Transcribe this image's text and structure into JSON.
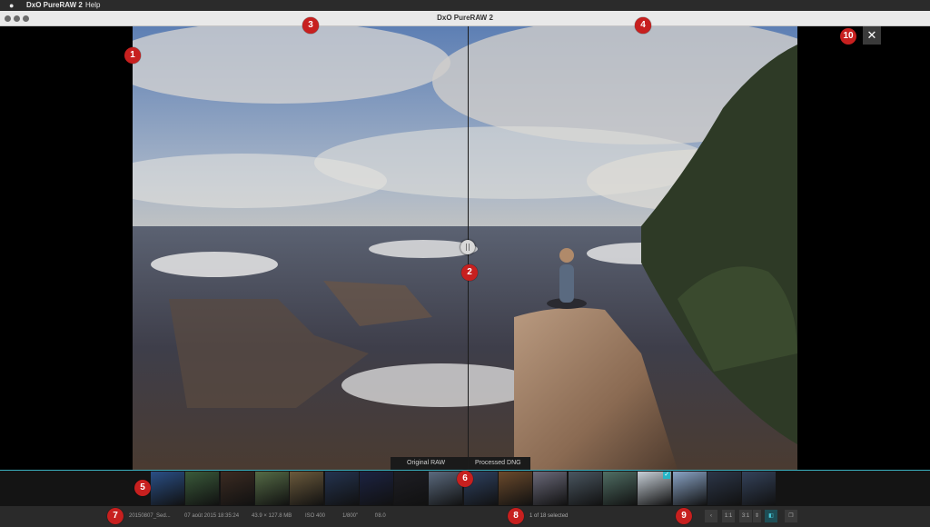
{
  "menubar": {
    "app": "DxO PureRAW 2",
    "help": "Help"
  },
  "window": {
    "title": "DxO PureRAW 2"
  },
  "compare": {
    "original_label": "Original RAW",
    "processed_label": "Processed DNG"
  },
  "close_label": "✕",
  "filmstrip": {
    "thumbnails": [
      {
        "color": "#2a4f86"
      },
      {
        "color": "#3a5a3a"
      },
      {
        "color": "#3b2b22"
      },
      {
        "color": "#556b46"
      },
      {
        "color": "#6b5a3c"
      },
      {
        "color": "#24334f"
      },
      {
        "color": "#1c2342"
      },
      {
        "color": "#1e1e24"
      },
      {
        "color": "#5b6a7e"
      },
      {
        "color": "#2f4262"
      },
      {
        "color": "#6b4a2c"
      },
      {
        "color": "#6b6a7a"
      },
      {
        "color": "#4a5660"
      },
      {
        "color": "#506e64"
      },
      {
        "color": "#c8d0d8",
        "checked": true
      },
      {
        "color": "#8aa4c6"
      },
      {
        "color": "#2c3648"
      },
      {
        "color": "#34425a"
      }
    ]
  },
  "status": {
    "filename": "20150807_Sed...",
    "datetime": "07 août 2015 18:35:24",
    "size": "43.9 × 127.8 MB",
    "iso": "ISO 400",
    "shutter": "1/800\"",
    "aperture": "f/8.0",
    "selection": "1 of 18 selected"
  },
  "toolbar": {
    "back": "‹",
    "zoom_fit": "1:1",
    "zoom_value": "3:1",
    "zoom_stepper": "⇕",
    "compare_view": "◧",
    "stack_view": "❐"
  },
  "badges": [
    "1",
    "2",
    "3",
    "4",
    "5",
    "6",
    "7",
    "8",
    "9",
    "10"
  ]
}
